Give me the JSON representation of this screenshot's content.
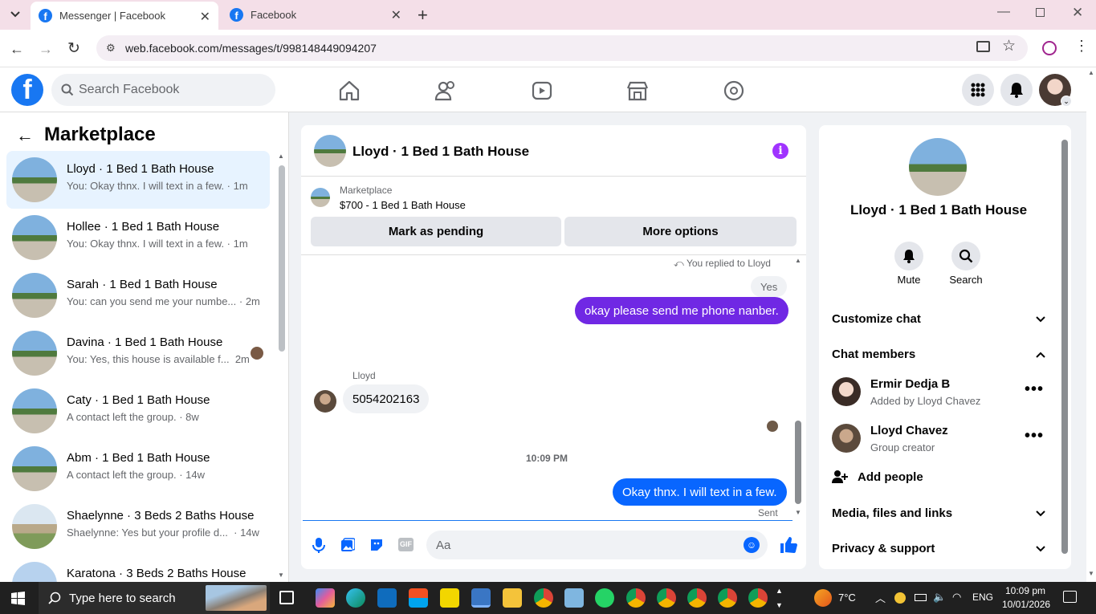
{
  "browser": {
    "tabs": [
      {
        "title": "Messenger | Facebook"
      },
      {
        "title": "Facebook"
      }
    ],
    "url": "web.facebook.com/messages/t/998148449094207"
  },
  "header": {
    "search_placeholder": "Search Facebook"
  },
  "sidebar": {
    "title": "Marketplace",
    "conversations": [
      {
        "name": "Lloyd · 1 Bed 1 Bath House",
        "preview": "You: Okay thnx. I will text in a few. · 1m"
      },
      {
        "name": "Hollee · 1 Bed 1 Bath House",
        "preview": "You: Okay thnx. I will text in a few. · 1m"
      },
      {
        "name": "Sarah · 1 Bed 1 Bath House",
        "preview": "You: can you send me your numbe... · 2m"
      },
      {
        "name": "Davina · 1 Bed 1 Bath House",
        "preview": "You: Yes, this house is available f...  2m"
      },
      {
        "name": "Caty · 1 Bed 1 Bath House",
        "preview": "A contact left the group. · 8w"
      },
      {
        "name": "Abm · 1 Bed 1 Bath House",
        "preview": "A contact left the group. · 14w"
      },
      {
        "name": "Shaelynne · 3 Beds 2 Baths House",
        "preview": "Shaelynne: Yes but your profile d...  · 14w"
      },
      {
        "name": "Karatona · 3 Beds 2 Baths House",
        "preview": ""
      }
    ]
  },
  "chat": {
    "title": "Lloyd · 1 Bed 1 Bath House",
    "listing": {
      "source": "Marketplace",
      "price_title": "$700 - 1 Bed 1 Bath House",
      "mark_pending": "Mark as pending",
      "more_options": "More options"
    },
    "messages": {
      "replied_label": "You replied to Lloyd",
      "quoted": "Yes",
      "sent1": "okay please send me phone nanber.",
      "sender_name": "Lloyd",
      "received": "5054202163",
      "timestamp": "10:09 PM",
      "sent2": "Okay thnx. I will text in a few.",
      "status": "Sent"
    },
    "composer_placeholder": "Aa"
  },
  "details": {
    "name": "Lloyd · 1 Bed 1 Bath House",
    "mute_label": "Mute",
    "search_label": "Search",
    "customize": "Customize chat",
    "members_heading": "Chat members",
    "members": [
      {
        "name": "Ermir Dedja B",
        "role": "Added by Lloyd Chavez"
      },
      {
        "name": "Lloyd Chavez",
        "role": "Group creator"
      }
    ],
    "add_people": "Add people",
    "media": "Media, files and links",
    "privacy": "Privacy & support"
  },
  "taskbar": {
    "search_placeholder": "Type here to search",
    "weather": "7°C",
    "lang": "ENG",
    "time": "10:09 pm",
    "date": "10/01/2026"
  },
  "colors": {
    "fb_blue": "#1877f2",
    "messenger_purple": "#7028e4",
    "sent_blue": "#0866ff",
    "active_bg": "#e7f3ff"
  }
}
